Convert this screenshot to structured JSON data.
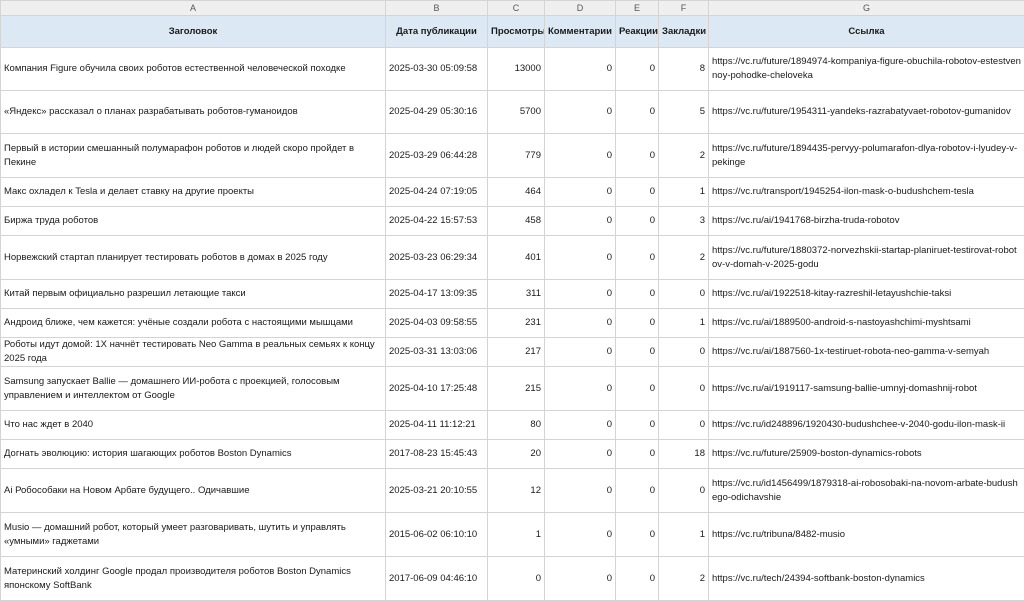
{
  "columns": [
    "A",
    "B",
    "C",
    "D",
    "E",
    "F",
    "G"
  ],
  "headers": {
    "title": "Заголовок",
    "date": "Дата публикации",
    "views": "Просмотры",
    "comments": "Комментарии",
    "reactions": "Реакции",
    "bookmarks": "Закладки",
    "link": "Ссылка"
  },
  "rows": [
    {
      "title": "Компания Figure обучила своих роботов естественной человеческой походке",
      "date": "2025-03-30 05:09:58",
      "views": "13000",
      "comments": "0",
      "reactions": "0",
      "bookmarks": "8",
      "link": "https://vc.ru/future/1894974-kompaniya-figure-obuchila-robotov-estestvennoy-pohodke-cheloveka"
    },
    {
      "title": "«Яндекс» рассказал о планах разрабатывать роботов-гуманоидов",
      "date": "2025-04-29 05:30:16",
      "views": "5700",
      "comments": "0",
      "reactions": "0",
      "bookmarks": "5",
      "link": "https://vc.ru/future/1954311-yandeks-razrabatyvaet-robotov-gumanidov"
    },
    {
      "title": "Первый в истории смешанный полумарафон роботов и людей скоро пройдет в Пекине",
      "date": "2025-03-29 06:44:28",
      "views": "779",
      "comments": "0",
      "reactions": "0",
      "bookmarks": "2",
      "link": "https://vc.ru/future/1894435-pervyy-polumarafon-dlya-robotov-i-lyudey-v-pekinge"
    },
    {
      "title": "Макс охладел к Tesla и делает ставку на другие проекты",
      "date": "2025-04-24 07:19:05",
      "views": "464",
      "comments": "0",
      "reactions": "0",
      "bookmarks": "1",
      "link": "https://vc.ru/transport/1945254-ilon-mask-o-budushchem-tesla"
    },
    {
      "title": "Биржа труда роботов",
      "date": "2025-04-22 15:57:53",
      "views": "458",
      "comments": "0",
      "reactions": "0",
      "bookmarks": "3",
      "link": "https://vc.ru/ai/1941768-birzha-truda-robotov"
    },
    {
      "title": "Норвежский стартап планирует тестировать роботов в домах в 2025 году",
      "date": "2025-03-23 06:29:34",
      "views": "401",
      "comments": "0",
      "reactions": "0",
      "bookmarks": "2",
      "link": "https://vc.ru/future/1880372-norvezhskii-startap-planiruet-testirovat-robotov-v-domah-v-2025-godu"
    },
    {
      "title": "Китай первым официально разрешил летающие такси",
      "date": "2025-04-17 13:09:35",
      "views": "311",
      "comments": "0",
      "reactions": "0",
      "bookmarks": "0",
      "link": "https://vc.ru/ai/1922518-kitay-razreshil-letayushchie-taksi"
    },
    {
      "title": "Андроид ближе, чем кажется: учёные создали робота с настоящими мышцами",
      "date": "2025-04-03 09:58:55",
      "views": "231",
      "comments": "0",
      "reactions": "0",
      "bookmarks": "1",
      "link": "https://vc.ru/ai/1889500-android-s-nastoyashchimi-myshtsami"
    },
    {
      "title": "Роботы идут домой: 1X начнёт тестировать Neo Gamma в реальных семьях к концу 2025 года",
      "date": "2025-03-31 13:03:06",
      "views": "217",
      "comments": "0",
      "reactions": "0",
      "bookmarks": "0",
      "link": "https://vc.ru/ai/1887560-1x-testiruet-robota-neo-gamma-v-semyah"
    },
    {
      "title": "Samsung запускает Ballie — домашнего ИИ-робота с проекцией, голосовым управлением и интеллектом от Google",
      "date": "2025-04-10 17:25:48",
      "views": "215",
      "comments": "0",
      "reactions": "0",
      "bookmarks": "0",
      "link": "https://vc.ru/ai/1919117-samsung-ballie-umnyj-domashnij-robot"
    },
    {
      "title": "Что нас ждет в 2040",
      "date": "2025-04-11 11:12:21",
      "views": "80",
      "comments": "0",
      "reactions": "0",
      "bookmarks": "0",
      "link": "https://vc.ru/id248896/1920430-budushchee-v-2040-godu-ilon-mask-ii"
    },
    {
      "title": "Догнать эволюцию: история шагающих роботов Boston Dynamics",
      "date": "2017-08-23 15:45:43",
      "views": "20",
      "comments": "0",
      "reactions": "0",
      "bookmarks": "18",
      "link": "https://vc.ru/future/25909-boston-dynamics-robots"
    },
    {
      "title": "Ai Робособаки на Новом Арбате будущего.. Одичавшие",
      "date": "2025-03-21 20:10:55",
      "views": "12",
      "comments": "0",
      "reactions": "0",
      "bookmarks": "0",
      "link": "https://vc.ru/id1456499/1879318-ai-robosobaki-na-novom-arbate-budushego-odichavshie"
    },
    {
      "title": "Musio — домашний робот, который умеет разговаривать, шутить и управлять «умными» гаджетами",
      "date": "2015-06-02 06:10:10",
      "views": "1",
      "comments": "0",
      "reactions": "0",
      "bookmarks": "1",
      "link": "https://vc.ru/tribuna/8482-musio"
    },
    {
      "title": "Материнский холдинг Google продал производителя роботов Boston Dynamics японскому SoftBank",
      "date": "2017-06-09 04:46:10",
      "views": "0",
      "comments": "0",
      "reactions": "0",
      "bookmarks": "2",
      "link": "https://vc.ru/tech/24394-softbank-boston-dynamics"
    }
  ]
}
